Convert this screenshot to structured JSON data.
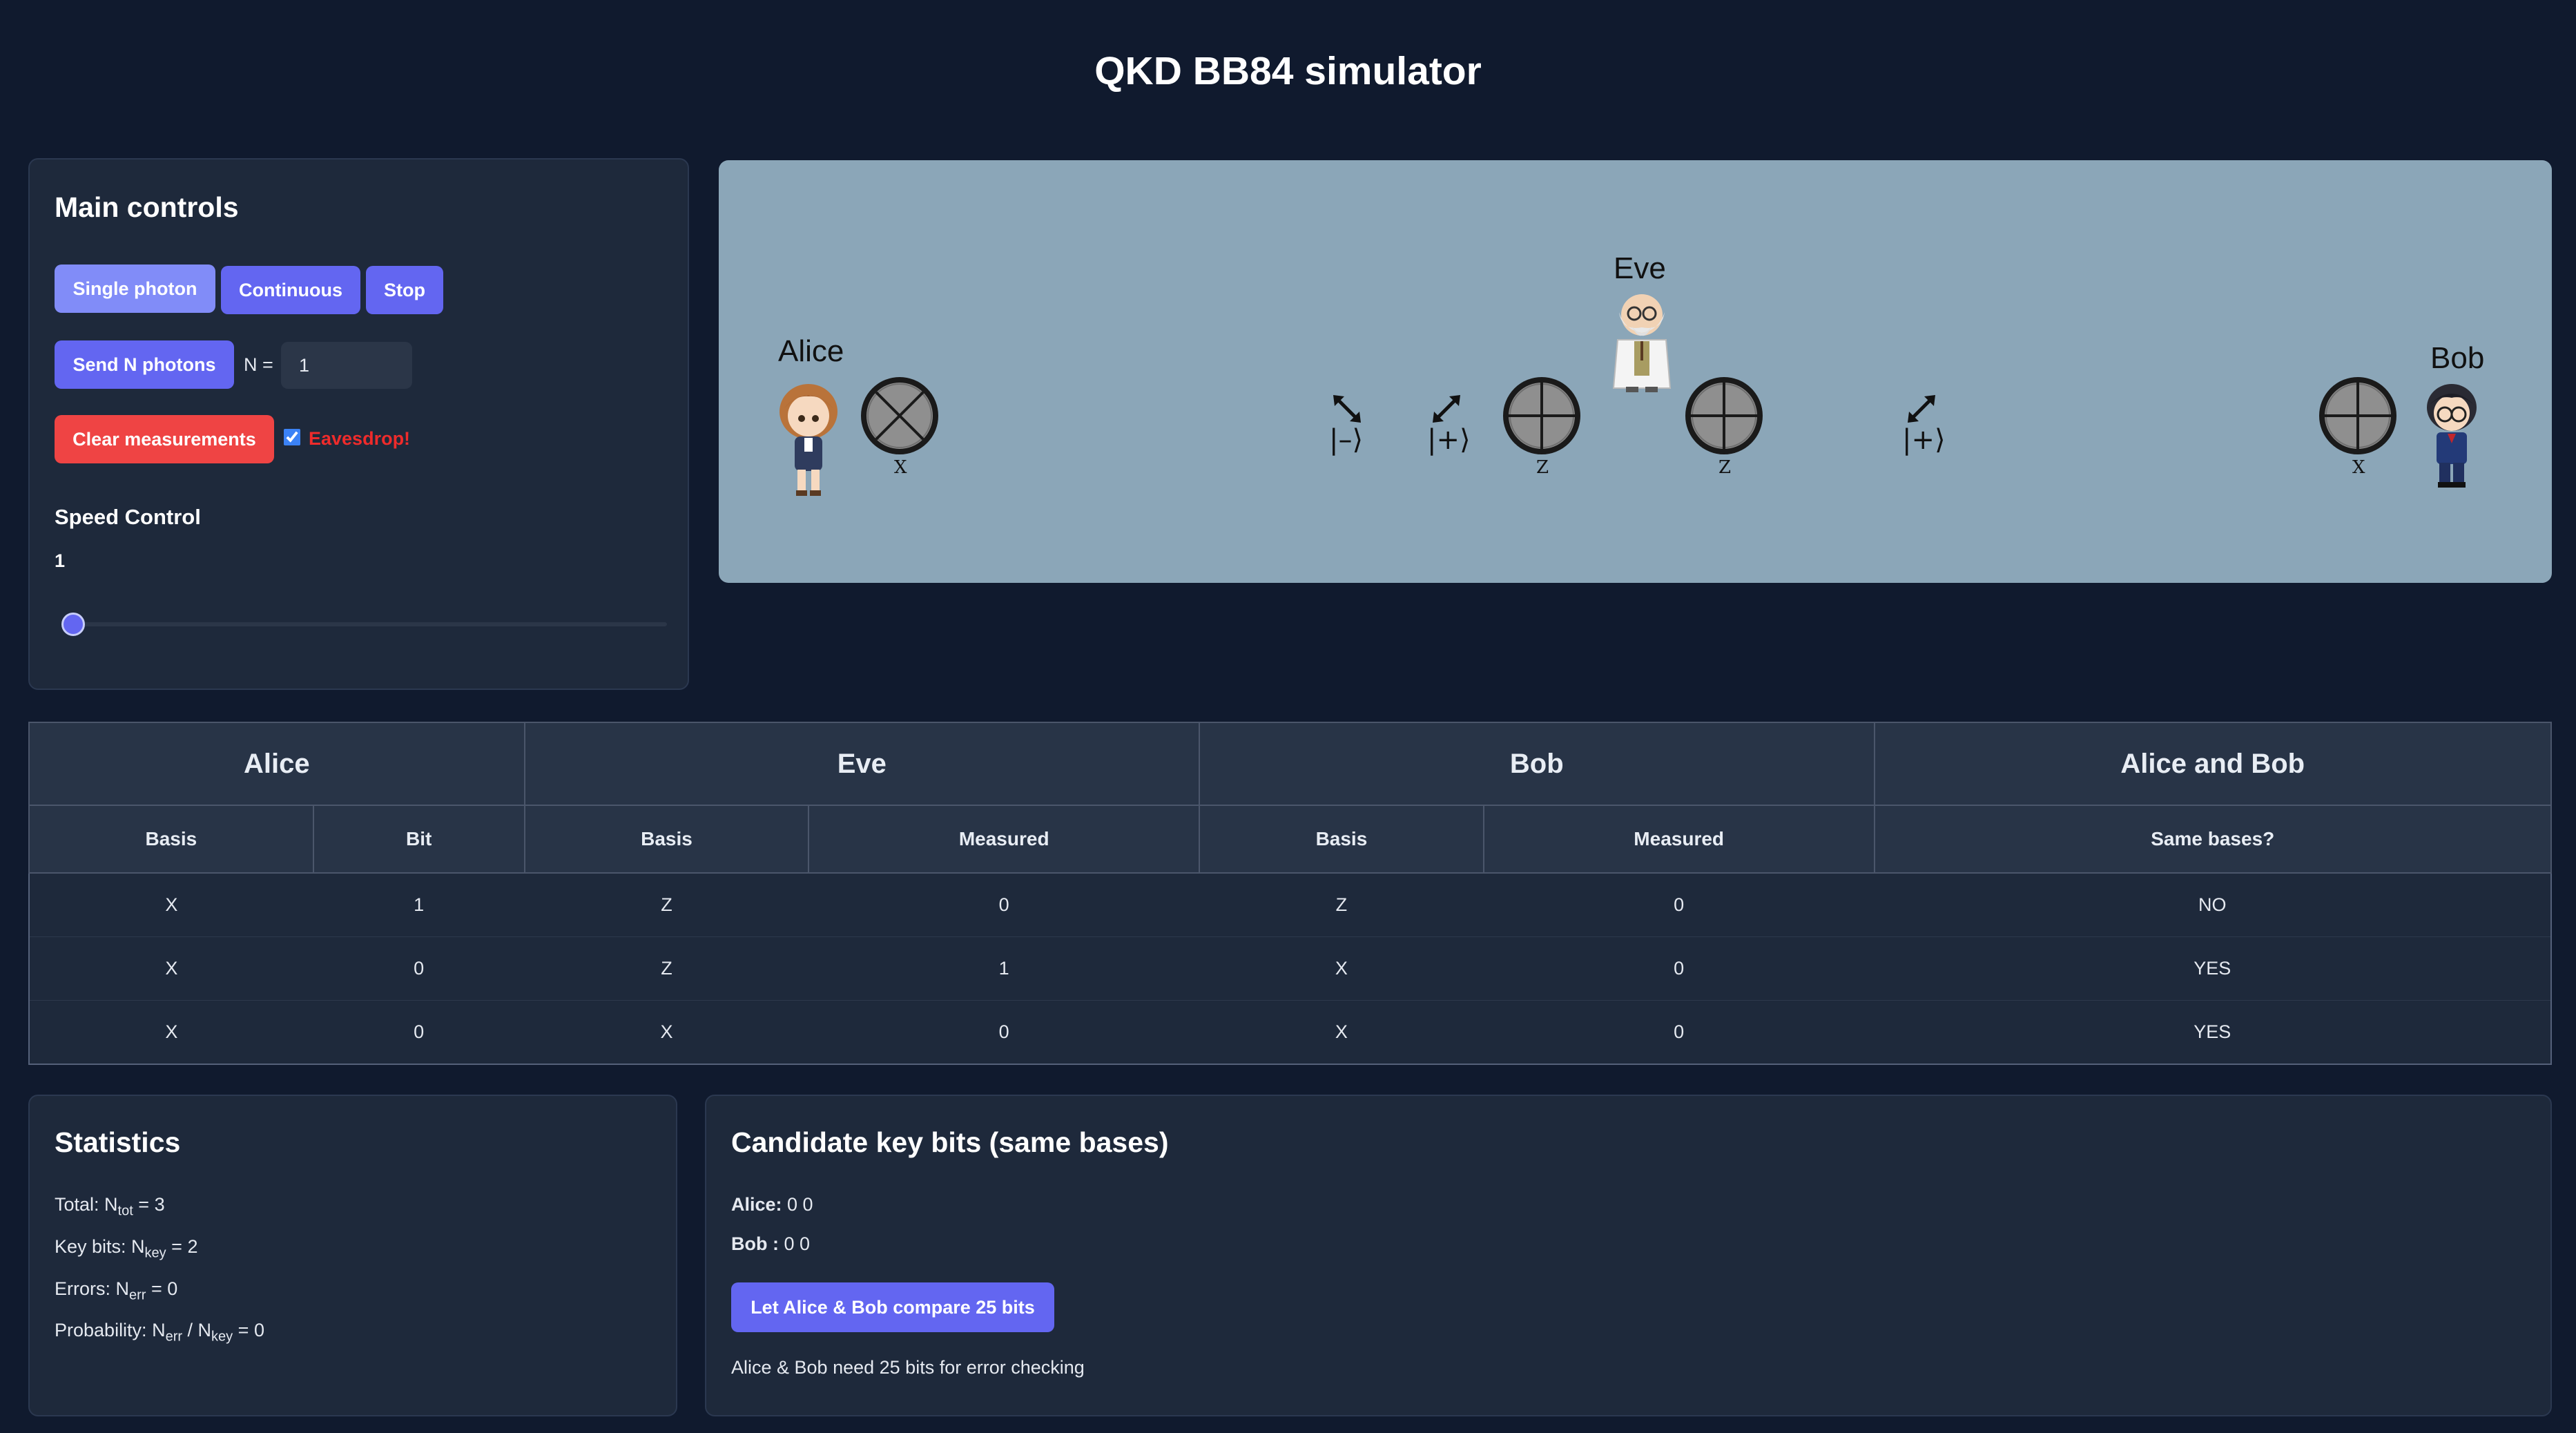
{
  "app": {
    "title": "QKD BB84 simulator"
  },
  "main_controls": {
    "title": "Main controls",
    "single_photon_label": "Single photon",
    "continuous_label": "Continuous",
    "stop_label": "Stop",
    "send_n_label": "Send N photons",
    "n_label": "N =",
    "n_value": "1",
    "clear_label": "Clear measurements",
    "eavesdrop_label": "Eavesdrop!",
    "eavesdrop_checked": true,
    "speed_title": "Speed Control",
    "speed_value": "1",
    "speed_level": 0
  },
  "simulation": {
    "alice_label": "Alice",
    "eve_label": "Eve",
    "bob_label": "Bob",
    "alice_basis": "X",
    "eve_in_basis": "Z",
    "eve_out_basis": "Z",
    "bob_basis": "X",
    "photon_states": [
      "|–⟩",
      "|+⟩",
      "|+⟩"
    ]
  },
  "table": {
    "groups": [
      "Alice",
      "Eve",
      "Bob",
      "Alice and Bob"
    ],
    "columns": [
      "Basis",
      "Bit",
      "Basis",
      "Measured",
      "Basis",
      "Measured",
      "Same bases?"
    ],
    "rows": [
      [
        "X",
        "1",
        "Z",
        "0",
        "Z",
        "0",
        "NO"
      ],
      [
        "X",
        "0",
        "Z",
        "1",
        "X",
        "0",
        "YES"
      ],
      [
        "X",
        "0",
        "X",
        "0",
        "X",
        "0",
        "YES"
      ]
    ]
  },
  "statistics": {
    "title": "Statistics",
    "total_prefix": "Total: N",
    "total_sub": "tot",
    "total_value": " = 3",
    "key_prefix": "Key bits: N",
    "key_sub": "key",
    "key_value": " = 2",
    "err_prefix": "Errors: N",
    "err_sub": "err",
    "err_value": " = 0",
    "prob_prefix": "Probability: N",
    "prob_sub1": "err",
    "prob_mid": " / N",
    "prob_sub2": "key",
    "prob_value": " = 0"
  },
  "candidate_key": {
    "title": "Candidate key bits (same bases)",
    "alice_label": "Alice:",
    "alice_bits": " 0 0",
    "bob_label": "Bob :",
    "bob_bits": " 0 0",
    "compare_label": "Let Alice & Bob compare 25 bits",
    "note": "Alice & Bob need 25 bits for error checking"
  },
  "colors": {
    "background": "#101a2e",
    "panel": "#1e293b",
    "primary": "#6366f1",
    "primary_light": "#818cf8",
    "danger": "#ef4444",
    "eavesdrop_text": "#ef2b2b",
    "canvas": "#8ba6b8"
  },
  "icons": [
    "alice-avatar-icon",
    "eve-avatar-icon",
    "bob-avatar-icon",
    "polarizer-x-icon",
    "polarizer-plus-icon",
    "photon-arrow-icon"
  ]
}
